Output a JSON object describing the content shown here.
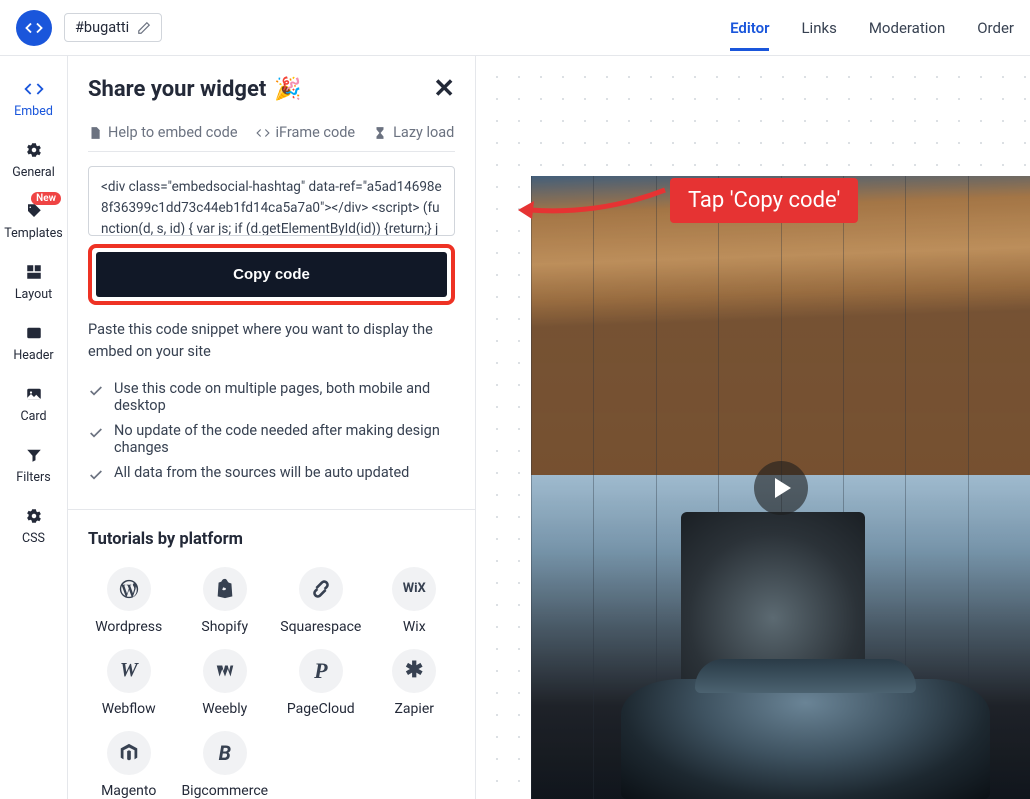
{
  "hashtag": "#bugatti",
  "top_nav": {
    "editor": "Editor",
    "links": "Links",
    "moderation": "Moderation",
    "order": "Order"
  },
  "sidebar": {
    "embed": "Embed",
    "general": "General",
    "templates": "Templates",
    "templates_badge": "New",
    "layout": "Layout",
    "header": "Header",
    "card": "Card",
    "filters": "Filters",
    "css": "CSS"
  },
  "panel": {
    "title": "Share your widget",
    "tabs": {
      "help": "Help to embed code",
      "iframe": "iFrame code",
      "lazy": "Lazy load"
    },
    "code": "<div class=\"embedsocial-hashtag\" data-ref=\"a5ad14698e8f36399c1dd73c44eb1fd14ca5a7a0\"></div> <script> (function(d, s, id) { var js; if (d.getElementById(id)) {return;} js = ",
    "copy": "Copy code",
    "desc": "Paste this code snippet where you want to display the embed on your site",
    "checks": {
      "c1": "Use this code on multiple pages, both mobile and desktop",
      "c2": "No update of the code needed after making design changes",
      "c3": "All data from the sources will be auto updated"
    },
    "tutorials_title": "Tutorials by platform",
    "platforms": {
      "wordpress": "Wordpress",
      "shopify": "Shopify",
      "squarespace": "Squarespace",
      "wix": "Wix",
      "webflow": "Webflow",
      "weebly": "Weebly",
      "pagecloud": "PageCloud",
      "zapier": "Zapier",
      "magento": "Magento",
      "bigcommerce": "Bigcommerce"
    }
  },
  "annotation": "Tap 'Copy code'"
}
